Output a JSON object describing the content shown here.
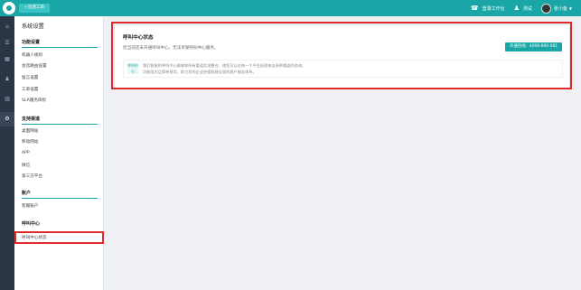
{
  "topbar": {
    "new_ticket": "+创建工单",
    "workspace": "登录工作台",
    "user_role": "测试",
    "user_name": "张小鱼",
    "colors": {
      "accent": "#1aa6a6",
      "highlight": "#e02b2b"
    },
    "icons": [
      "logo-icon",
      "headset-icon",
      "user-icon",
      "chevron-down-icon"
    ]
  },
  "rail": {
    "icons": [
      "home-icon",
      "list-icon",
      "grid-icon",
      "user-icon",
      "chart-icon",
      "gear-icon"
    ]
  },
  "nav": {
    "title": "系统设置",
    "sections": {
      "func": {
        "title": "功能设置",
        "items": [
          "机器人规则",
          "会话路由设置",
          "留言设置",
          "工单设置",
          "SLA服务目标"
        ]
      },
      "support": {
        "title": "支持渠道",
        "items": [
          "桌面网站",
          "移动网站",
          "APP",
          "微信",
          "第三方平台"
        ]
      },
      "account": {
        "title": "账户",
        "items": [
          "客服账户"
        ]
      },
      "callcenter": {
        "title": "呼叫中心",
        "items": [
          "呼叫中心状态"
        ]
      }
    }
  },
  "main": {
    "title": "呼叫中心状态",
    "desc": "您当前还未开通呼叫中心，无法享受呼叫中心服务。",
    "hotline_button": "开通热线：4008-890-081",
    "tip": {
      "icon_label": "呼叫中心",
      "line1": "我们智能的呼叫中心能够和所有渠道实现整合，使您可以在统一个平台处理来自多种渠道的咨询。",
      "line2": "功能强大且简单易用，助力您的企业快速构建全面的客户服务体系。"
    }
  }
}
